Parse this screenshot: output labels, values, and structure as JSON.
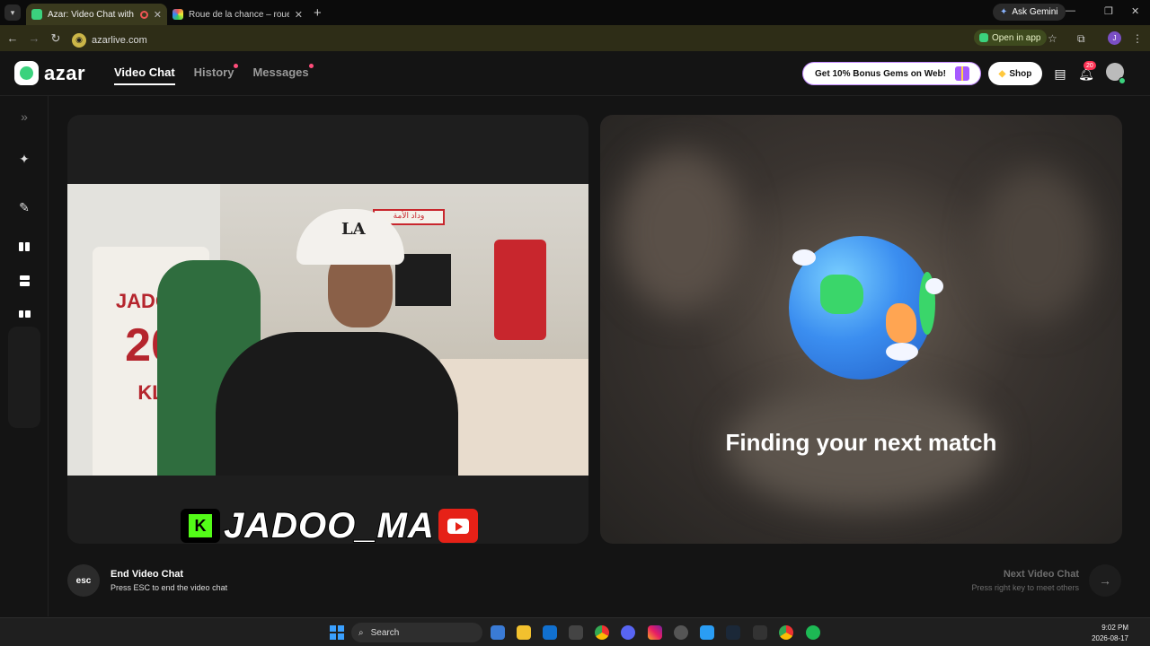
{
  "browser": {
    "tabs": [
      {
        "title": "Azar: Video Chat with New",
        "active": true,
        "favicon_color": "#3bd27d"
      },
      {
        "title": "Roue de la chance – roue aléatoire",
        "active": false,
        "favicon_color": "#e6a23c"
      }
    ],
    "new_tab": "+",
    "ask_gemini": "Ask Gemini",
    "url": "azarlive.com",
    "open_in_app": "Open in app",
    "profile_initial": "J"
  },
  "header": {
    "logo_text": "azar",
    "nav": [
      {
        "label": "Video Chat",
        "active": true,
        "dot": false
      },
      {
        "label": "History",
        "active": false,
        "dot": true
      },
      {
        "label": "Messages",
        "active": false,
        "dot": true
      }
    ],
    "promo": "Get 10% Bonus Gems on Web!",
    "shop": "Shop",
    "notifications_count": "20"
  },
  "sidebar": {
    "expand_icon": "»"
  },
  "left_panel": {
    "jersey_name": "JADOO",
    "jersey_number": "20",
    "jersey_initials": "KL",
    "banner_text": "وداد الأمة",
    "cap_logo": "LA",
    "streamer_name": "JADOO_MA"
  },
  "right_panel": {
    "status": "Finding your next match"
  },
  "controls": {
    "esc_label": "esc",
    "end_title": "End Video Chat",
    "end_sub": "Press ESC to end the video chat",
    "next_title": "Next Video Chat",
    "next_sub": "Press right key to meet others",
    "next_arrow": "→"
  },
  "taskbar": {
    "search": "Search",
    "time": "9:02 PM",
    "date": "2026-08-17"
  },
  "colors": {
    "accent": "#3bd27d",
    "notification": "#ff3355",
    "promo_border": "#c38bff"
  }
}
